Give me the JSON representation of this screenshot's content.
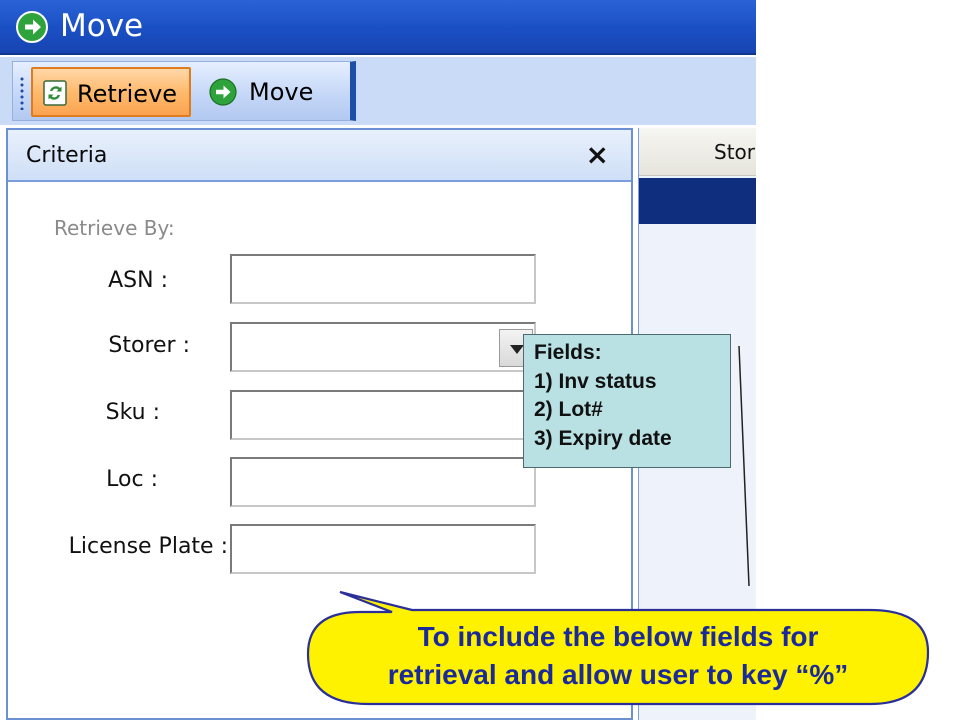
{
  "window": {
    "title": "Move"
  },
  "toolbar": {
    "retrieve_label": "Retrieve",
    "move_label": "Move"
  },
  "criteria_panel": {
    "title": "Criteria",
    "close_glyph": "×",
    "section_label": "Retrieve By:",
    "fields": [
      {
        "label": "ASN :",
        "value": "",
        "type": "text"
      },
      {
        "label": "Storer :",
        "value": "",
        "type": "dropdown"
      },
      {
        "label": "Sku :",
        "value": "",
        "type": "text"
      },
      {
        "label": "Loc :",
        "value": "",
        "type": "text"
      },
      {
        "label": "License Plate :",
        "value": "",
        "type": "text"
      }
    ]
  },
  "grid": {
    "header_partial": "Stor"
  },
  "annotation_fields": {
    "title": "Fields:",
    "items": [
      "1)  Inv status",
      "2)   Lot#",
      "3)  Expiry date"
    ]
  },
  "annotation_callout": {
    "line1": "To include the below fields for",
    "line2": "retrieval and allow user to key “%”"
  },
  "colors": {
    "titlebar": "#1a4fc4",
    "retrieve_highlight": "#ffba6d",
    "callout_fill": "#fff200",
    "callout_text": "#1b2a9a",
    "fields_box": "#b9e1e4"
  },
  "icons": {
    "window": "arrow-right-circle-icon",
    "retrieve": "refresh-document-icon",
    "move": "arrow-right-circle-icon",
    "close": "close-icon",
    "dropdown": "chevron-down-icon"
  }
}
